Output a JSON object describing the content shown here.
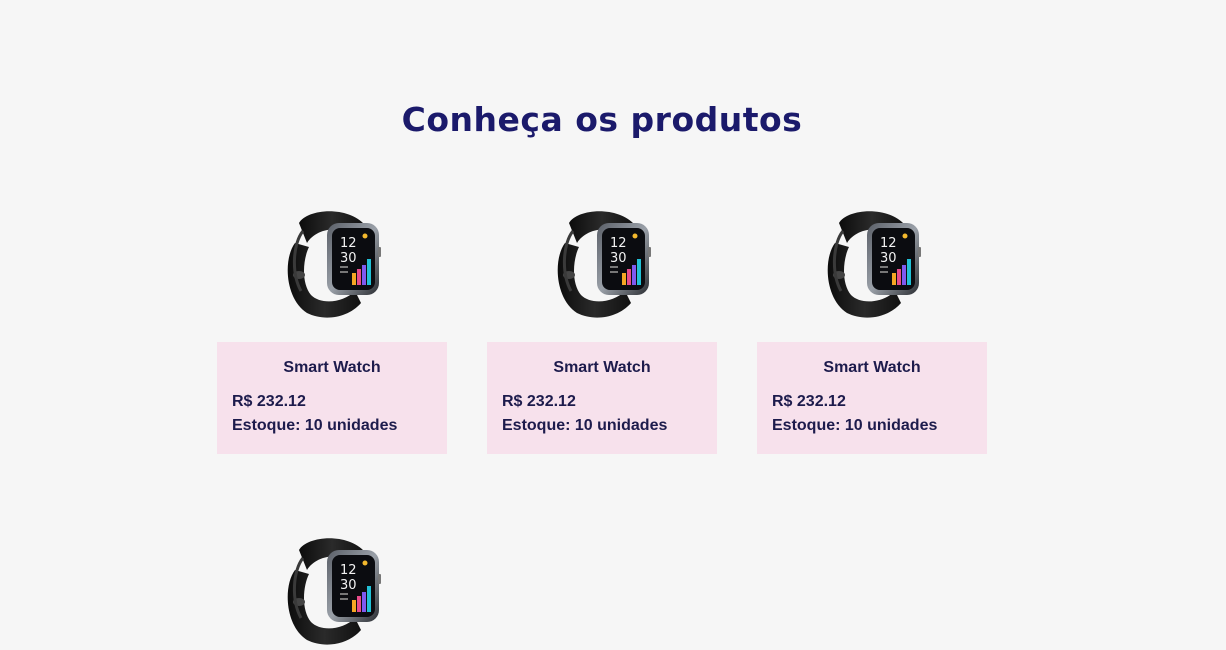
{
  "section": {
    "title": "Conheça os produtos"
  },
  "products": [
    {
      "name": "Smart Watch",
      "price": "R$ 232.12",
      "stock": "Estoque: 10 unidades",
      "icon": "smartwatch-image"
    },
    {
      "name": "Smart Watch",
      "price": "R$ 232.12",
      "stock": "Estoque: 10 unidades",
      "icon": "smartwatch-image"
    },
    {
      "name": "Smart Watch",
      "price": "R$ 232.12",
      "stock": "Estoque: 10 unidades",
      "icon": "smartwatch-image"
    },
    {
      "icon": "smartwatch-image"
    }
  ],
  "colors": {
    "background": "#f6f6f6",
    "title": "#1b1a6b",
    "card_background": "#f7e1ec",
    "card_text": "#1d1b4c"
  }
}
